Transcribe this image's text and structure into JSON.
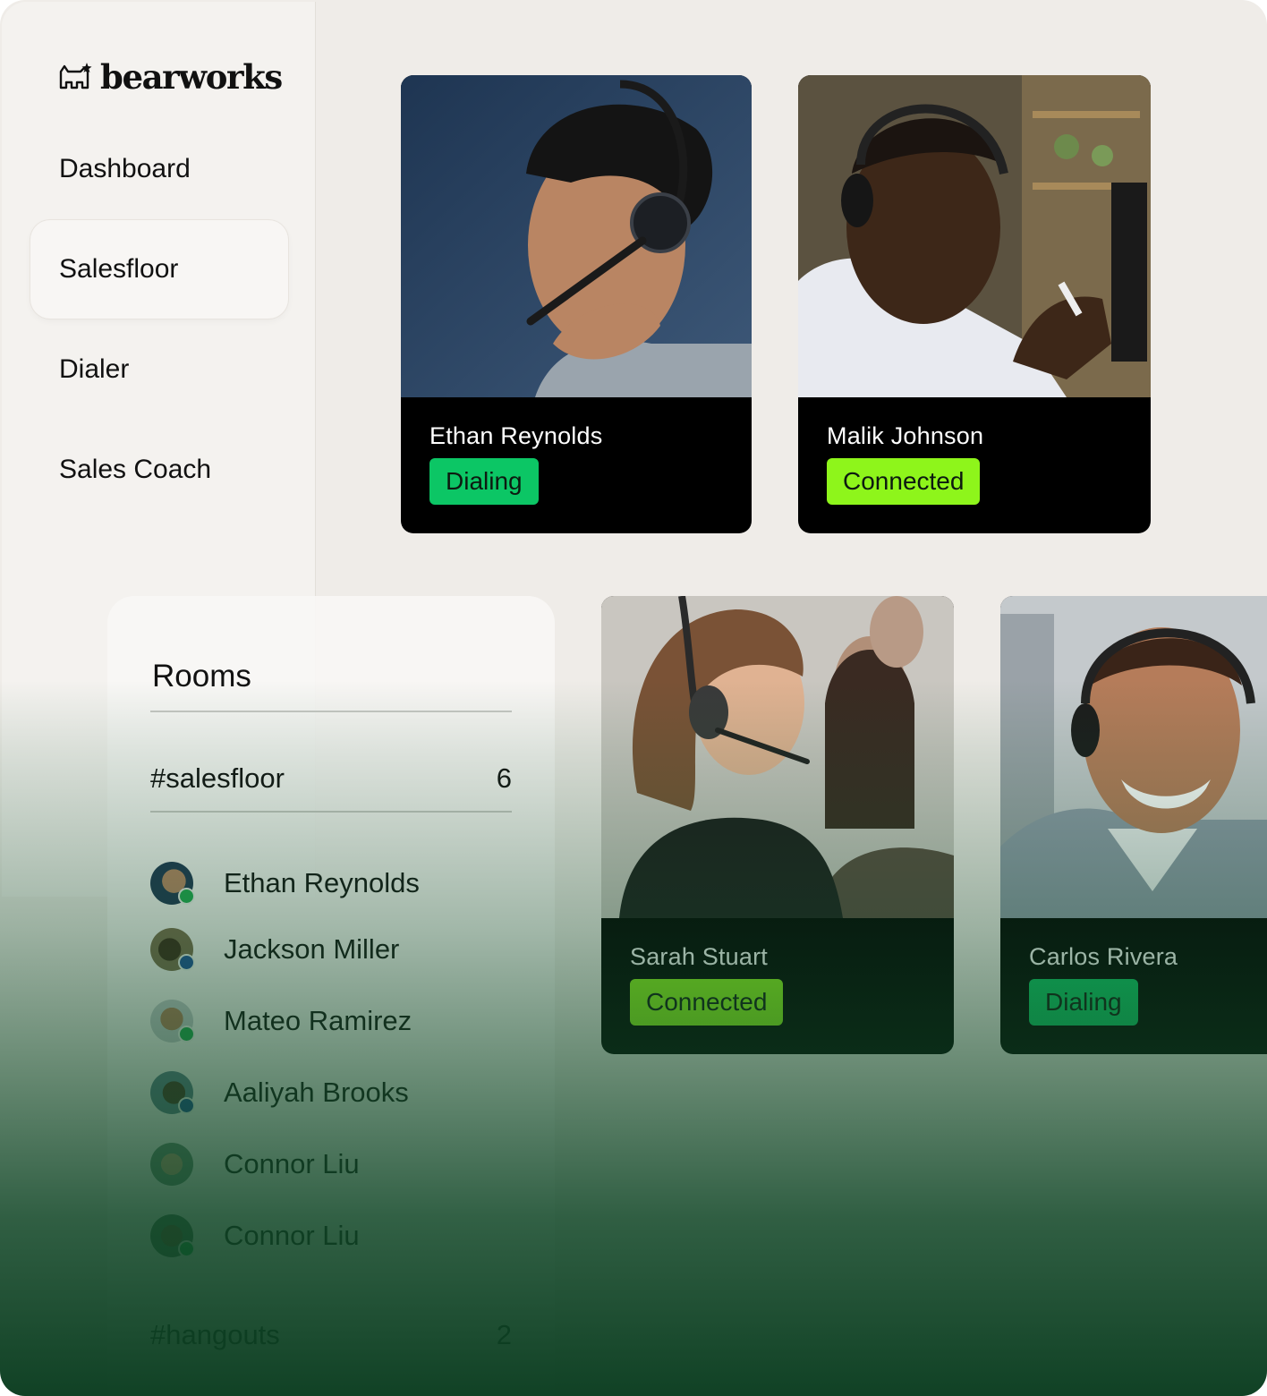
{
  "brand": {
    "name": "bearworks",
    "logo_icon": "bear-logo-icon"
  },
  "sidebar": {
    "items": [
      {
        "label": "Dashboard",
        "active": false
      },
      {
        "label": "Salesfloor",
        "active": true
      },
      {
        "label": "Dialer",
        "active": false
      },
      {
        "label": "Sales Coach",
        "active": false
      }
    ]
  },
  "agents": [
    {
      "name": "Ethan Reynolds",
      "status": "Dialing",
      "status_color": "#0cc665"
    },
    {
      "name": "Malik Johnson",
      "status": "Connected",
      "status_color": "#8ef51b"
    },
    {
      "name": "Sarah Stuart",
      "status": "Connected",
      "status_color": "#8ef51b"
    },
    {
      "name": "Carlos Rivera",
      "status": "Dialing",
      "status_color": "#0cc665"
    }
  ],
  "rooms": {
    "title": "Rooms",
    "channels": [
      {
        "name": "#salesfloor",
        "count": "6"
      },
      {
        "name": "#hangouts",
        "count": "2"
      }
    ],
    "members": [
      {
        "name": "Ethan Reynolds",
        "presence_color": "#1faa4f"
      },
      {
        "name": "Jackson Miller",
        "presence_color": "#1d4f9a"
      },
      {
        "name": "Mateo Ramirez",
        "presence_color": "#1faa4f"
      },
      {
        "name": "Aaliyah Brooks",
        "presence_color": "#1d4f9a"
      },
      {
        "name": "Connor Liu",
        "presence_color": ""
      },
      {
        "name": "Connor Liu",
        "presence_color": "#1faa4f"
      }
    ]
  }
}
